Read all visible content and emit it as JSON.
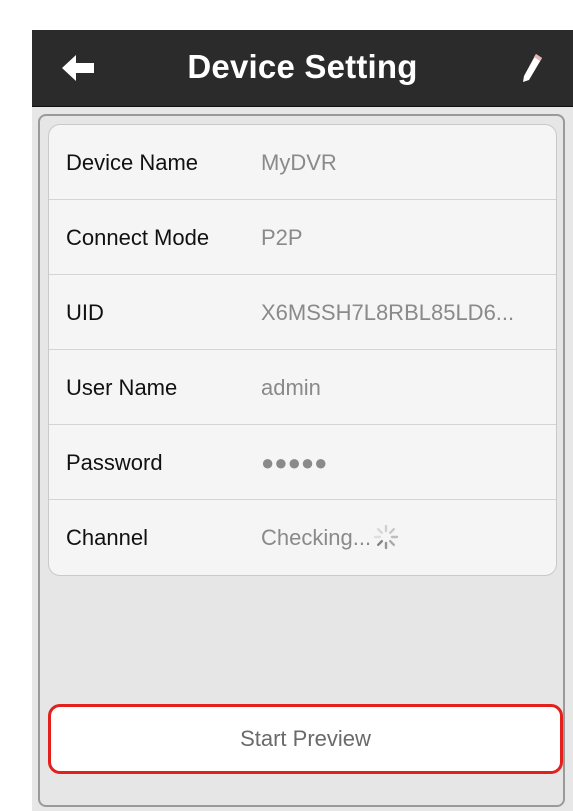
{
  "navbar": {
    "title": "Device Setting",
    "back_icon": "back-arrow-icon",
    "edit_icon": "pencil-icon"
  },
  "settings": {
    "rows": [
      {
        "label": "Device Name",
        "value": "MyDVR"
      },
      {
        "label": "Connect Mode",
        "value": "P2P"
      },
      {
        "label": "UID",
        "value": "X6MSSH7L8RBL85LD6..."
      },
      {
        "label": "User Name",
        "value": "admin"
      },
      {
        "label": "Password",
        "value": "●●●●●"
      },
      {
        "label": "Channel",
        "value": "Checking...",
        "status_icon": "loading-spinner-icon"
      }
    ]
  },
  "actions": {
    "start_preview_label": "Start Preview"
  },
  "colors": {
    "navbar_bg": "#2b2b2b",
    "highlight_border": "#e3201b",
    "value_text": "#8a8a8a"
  }
}
